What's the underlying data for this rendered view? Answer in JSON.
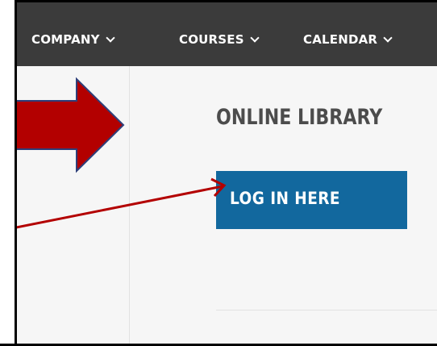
{
  "nav": {
    "items": [
      {
        "label": "COMPANY",
        "icon": "chevron-down-icon"
      },
      {
        "label": "COURSES",
        "icon": "chevron-down-icon"
      },
      {
        "label": "CALENDAR",
        "icon": "chevron-down-icon"
      }
    ]
  },
  "main": {
    "title": "ONLINE LIBRARY",
    "login_button_label": "LOG IN HERE"
  },
  "annotations": {
    "block_arrow": "block-arrow-icon",
    "pointer_arrow": "pointer-arrow-icon"
  },
  "colors": {
    "navbar_bg": "#3b3b3b",
    "button_bg": "#12689e",
    "arrow_fill": "#b30000",
    "arrow_stroke": "#2e3f7a",
    "title_color": "#4c4c4c"
  }
}
